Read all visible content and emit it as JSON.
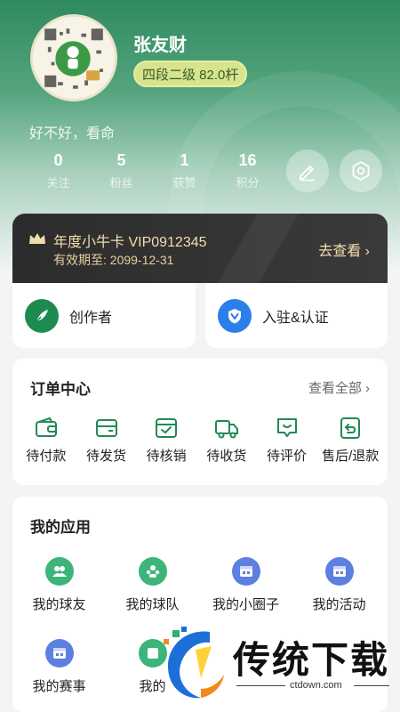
{
  "profile": {
    "name": "张友财",
    "level_badge": "四段二级 82.0杆",
    "bio": "好不好，看命"
  },
  "stats": [
    {
      "value": "0",
      "label": "关注"
    },
    {
      "value": "5",
      "label": "粉丝"
    },
    {
      "value": "1",
      "label": "获赞"
    },
    {
      "value": "16",
      "label": "积分"
    }
  ],
  "actions": {
    "edit_icon": "pencil-icon",
    "settings_icon": "hexagon-settings-icon"
  },
  "vip": {
    "title": "年度小牛卡 VIP0912345",
    "expire": "有效期至: 2099-12-31",
    "link": "去查看 ›"
  },
  "tiles": [
    {
      "label": "创作者",
      "icon": "quill-icon",
      "color": "#1d8a4f"
    },
    {
      "label": "入驻&认证",
      "icon": "verified-shield-icon",
      "color": "#2c7ee8"
    }
  ],
  "orders": {
    "title": "订单中心",
    "more": "查看全部 ›",
    "items": [
      {
        "label": "待付款",
        "icon": "wallet-icon"
      },
      {
        "label": "待发货",
        "icon": "box-icon"
      },
      {
        "label": "待核销",
        "icon": "verify-package-icon"
      },
      {
        "label": "待收货",
        "icon": "truck-icon"
      },
      {
        "label": "待评价",
        "icon": "comment-icon"
      },
      {
        "label": "售后/退款",
        "icon": "refund-icon"
      }
    ]
  },
  "apps": {
    "title": "我的应用",
    "items": [
      {
        "label": "我的球友",
        "icon": "people-icon",
        "color": "#3cb47a"
      },
      {
        "label": "我的球队",
        "icon": "team-icon",
        "color": "#3cb47a"
      },
      {
        "label": "我的小圈子",
        "icon": "calendar-icon",
        "color": "#5c7fe0"
      },
      {
        "label": "我的活动",
        "icon": "calendar-icon",
        "color": "#5c7fe0"
      },
      {
        "label": "我的赛事",
        "icon": "calendar-icon",
        "color": "#5c7fe0"
      },
      {
        "label": "我的",
        "icon": "app-icon",
        "color": "#3cb47a"
      }
    ]
  },
  "watermark": {
    "text": "传统下载",
    "url": "ctdown.com"
  },
  "colors": {
    "brand_green": "#1f8a55",
    "icon_green": "#1f8a55",
    "vip_gold": "#f3dcae"
  }
}
